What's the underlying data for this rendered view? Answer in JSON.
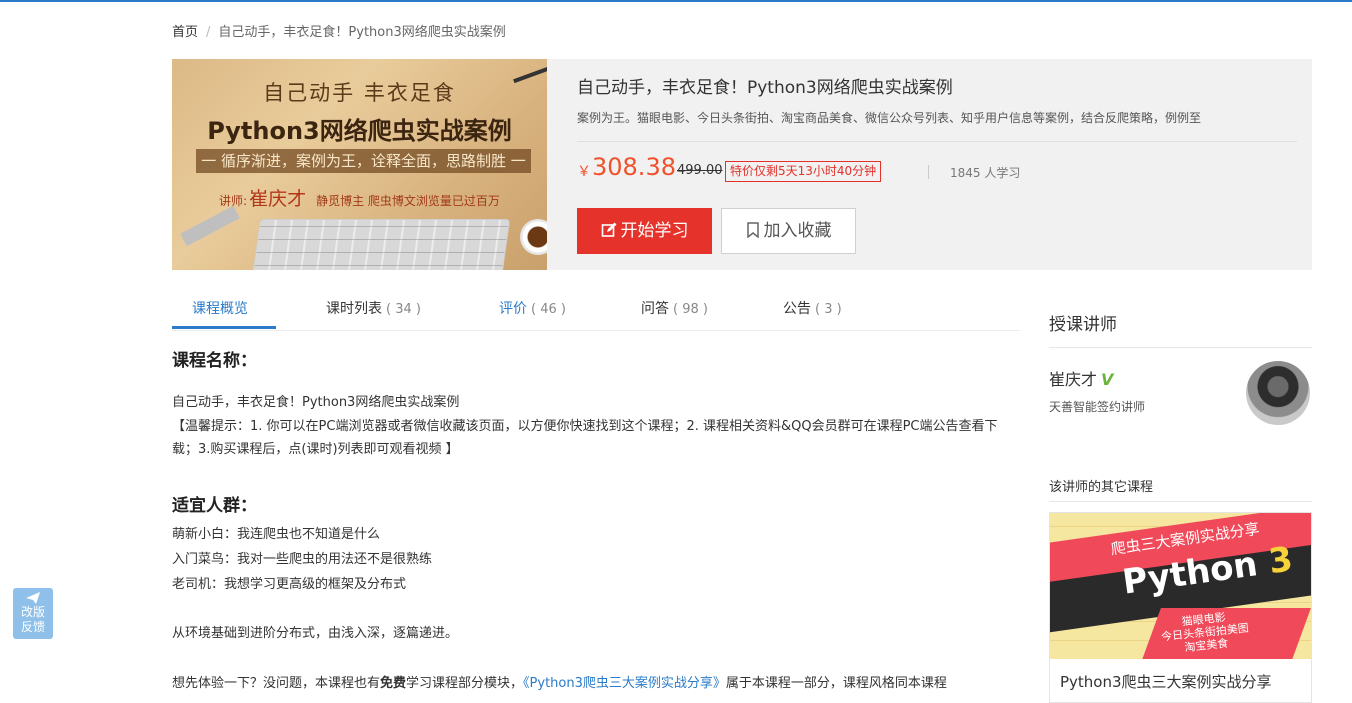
{
  "breadcrumb": {
    "home": "首页",
    "separator": "/",
    "current": "自己动手，丰衣足食！Python3网络爬虫实战案例"
  },
  "cover": {
    "line1": "自己动手 丰衣足食",
    "line2": "Python3网络爬虫实战案例",
    "band": "一 循序渐进，案例为王，诠释全面，思路制胜 一",
    "lecturer_prefix": "讲师:",
    "lecturer_name": "崔庆才",
    "lecturer_note": "静觅博主 爬虫博文浏览量已过百万"
  },
  "course": {
    "title": "自己动手，丰衣足食！Python3网络爬虫实战案例",
    "desc": "案例为王。猫眼电影、今日头条街拍、淘宝商品美食、微信公众号列表、知乎用户信息等案例，结合反爬策略，例例至",
    "currency": "￥",
    "price": "308.38",
    "original_price": "499.00",
    "promo": "特价仅剩5天13小时40分钟",
    "learners": "1845 人学习",
    "start_label": "开始学习",
    "fav_label": "加入收藏"
  },
  "tabs": [
    {
      "label": "课程概览",
      "count": ""
    },
    {
      "label": "课时列表",
      "count": "( 34 )"
    },
    {
      "label": "评价",
      "count": "( 46 )"
    },
    {
      "label": "问答",
      "count": "( 98 )"
    },
    {
      "label": "公告",
      "count": "( 3 )"
    }
  ],
  "content": {
    "h_name": "课程名称：",
    "name_line": "自己动手，丰衣足食！Python3网络爬虫实战案例",
    "tip": "【温馨提示：1. 你可以在PC端浏览器或者微信收藏该页面，以方便你快速找到这个课程；2. 课程相关资料&QQ会员群可在课程PC端公告查看下载；3.购买课程后，点(课时)列表即可观看视频 】",
    "h_audience": "适宜人群：",
    "audience": [
      "萌新小白：我连爬虫也不知道是什么",
      "入门菜鸟：我对一些爬虫的用法还不是很熟练",
      "老司机：我想学习更高级的框架及分布式"
    ],
    "progress": "从环境基础到进阶分布式，由浅入深，逐篇递进。",
    "trial_a": "想先体验一下？没问题，本课程也有",
    "trial_bold": "免费",
    "trial_b": "学习课程部分模块，",
    "trial_link": "《Python3爬虫三大案例实战分享》",
    "trial_c": "属于本课程一部分，课程风格同本课程"
  },
  "sidebar": {
    "title": "授课讲师",
    "teacher_name": "崔庆才",
    "v_badge": "V",
    "teacher_sub": "天善智能签约讲师",
    "others_title": "该讲师的其它课程",
    "card": {
      "banner": "爬虫三大案例实战分享",
      "python": "Python",
      "num": "3",
      "small1": "猫眼电影",
      "small2": "今日头条街拍美图",
      "small3": "淘宝美食",
      "name": "Python3爬虫三大案例实战分享"
    }
  },
  "feedback": {
    "line1": "改版",
    "line2": "反馈"
  },
  "colors": {
    "accent": "#2a7bc9",
    "price": "#f0512b",
    "start_button": "#e5322a",
    "promo_border": "#e4312a",
    "v_badge": "#6ab43a"
  },
  "icons": {
    "start": "edit-icon",
    "fav": "bookmark-icon",
    "feedback": "paper-plane-icon"
  }
}
